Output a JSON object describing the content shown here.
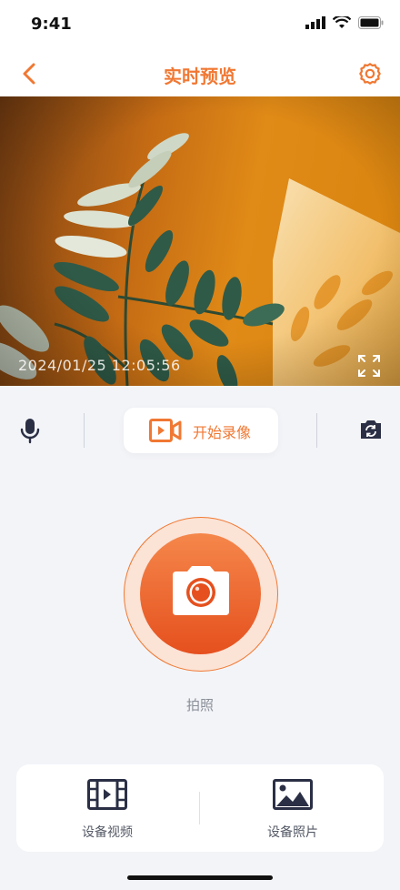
{
  "status_bar": {
    "time": "9:41"
  },
  "nav": {
    "title": "实时预览"
  },
  "preview": {
    "timestamp": "2024/01/25 12:05:56"
  },
  "controls": {
    "record_label": "开始录像"
  },
  "shutter": {
    "label": "拍照"
  },
  "bottom": {
    "items": [
      {
        "label": "设备视频",
        "icon": "video-file-icon"
      },
      {
        "label": "设备照片",
        "icon": "image-icon"
      }
    ]
  },
  "colors": {
    "accent": "#f07833",
    "icon_dark": "#2b2f45"
  }
}
